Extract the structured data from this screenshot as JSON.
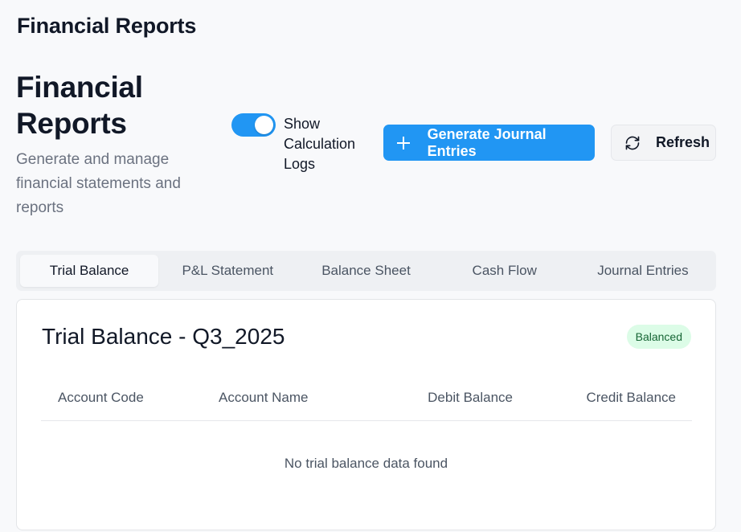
{
  "app": {
    "title": "Financial Reports"
  },
  "header": {
    "title": "Financial Reports",
    "subtitle": "Generate and manage financial statements and reports"
  },
  "controls": {
    "toggle": {
      "label": "Show Calculation Logs",
      "on": true
    },
    "generate_label": "Generate Journal Entries",
    "refresh_label": "Refresh"
  },
  "tabs": [
    {
      "label": "Trial Balance",
      "active": true
    },
    {
      "label": "P&L Statement",
      "active": false
    },
    {
      "label": "Balance Sheet",
      "active": false
    },
    {
      "label": "Cash Flow",
      "active": false
    },
    {
      "label": "Journal Entries",
      "active": false
    }
  ],
  "card": {
    "title": "Trial Balance - Q3_2025",
    "status_badge": "Balanced",
    "columns": [
      "Account Code",
      "Account Name",
      "Debit Balance",
      "Credit Balance"
    ],
    "rows": [],
    "empty_message": "No trial balance data found"
  },
  "colors": {
    "accent": "#2196f3",
    "badge_bg": "#dcfce7",
    "badge_text": "#166534"
  },
  "icons": {
    "generate": "plus-icon",
    "refresh": "refresh-icon"
  }
}
